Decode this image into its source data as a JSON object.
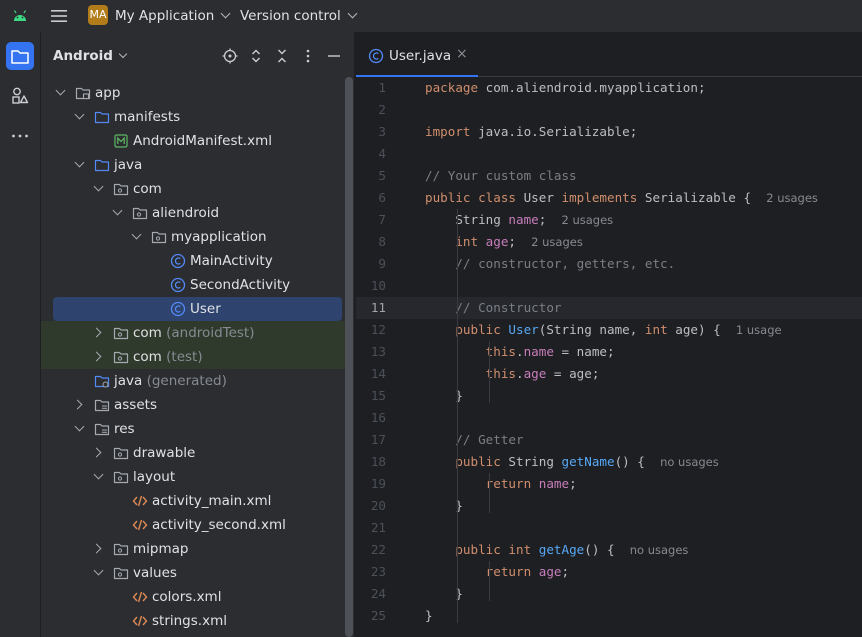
{
  "titlebar": {
    "project_badge": "MA",
    "project_name": "My Application",
    "vcs": "Version control"
  },
  "project_panel": {
    "view": "Android"
  },
  "tree": [
    {
      "label": "app",
      "hint": ""
    },
    {
      "label": "manifests",
      "hint": ""
    },
    {
      "label": "AndroidManifest.xml",
      "hint": ""
    },
    {
      "label": "java",
      "hint": ""
    },
    {
      "label": "com",
      "hint": ""
    },
    {
      "label": "aliendroid",
      "hint": ""
    },
    {
      "label": "myapplication",
      "hint": ""
    },
    {
      "label": "MainActivity",
      "hint": ""
    },
    {
      "label": "SecondActivity",
      "hint": ""
    },
    {
      "label": "User",
      "hint": ""
    },
    {
      "label": "com",
      "hint": "(androidTest)"
    },
    {
      "label": "com",
      "hint": "(test)"
    },
    {
      "label": "java",
      "hint": "(generated)"
    },
    {
      "label": "assets",
      "hint": ""
    },
    {
      "label": "res",
      "hint": ""
    },
    {
      "label": "drawable",
      "hint": ""
    },
    {
      "label": "layout",
      "hint": ""
    },
    {
      "label": "activity_main.xml",
      "hint": ""
    },
    {
      "label": "activity_second.xml",
      "hint": ""
    },
    {
      "label": "mipmap",
      "hint": ""
    },
    {
      "label": "values",
      "hint": ""
    },
    {
      "label": "colors.xml",
      "hint": ""
    },
    {
      "label": "strings.xml",
      "hint": ""
    }
  ],
  "editor": {
    "tab_label": "User.java",
    "tab_close": "×",
    "current_line": 11,
    "lines": [
      {
        "n": "1",
        "tokens": [
          [
            "kw",
            "package "
          ],
          [
            "",
            "com.aliendroid.myapplication;"
          ]
        ]
      },
      {
        "n": "2",
        "tokens": []
      },
      {
        "n": "3",
        "tokens": [
          [
            "kw",
            "import "
          ],
          [
            "",
            "java.io.Serializable;"
          ]
        ]
      },
      {
        "n": "4",
        "tokens": []
      },
      {
        "n": "5",
        "tokens": [
          [
            "cm",
            "// Your custom class"
          ]
        ]
      },
      {
        "n": "6",
        "tokens": [
          [
            "kw",
            "public class "
          ],
          [
            "",
            "User "
          ],
          [
            "kw",
            "implements "
          ],
          [
            "",
            "Serializable {  "
          ],
          [
            "usage",
            "2 usages"
          ]
        ]
      },
      {
        "n": "7",
        "tokens": [
          [
            "",
            "    String "
          ],
          [
            "fld",
            "name"
          ],
          [
            "",
            ";  "
          ],
          [
            "usage",
            "2 usages"
          ]
        ]
      },
      {
        "n": "8",
        "tokens": [
          [
            "kw",
            "    int "
          ],
          [
            "fld",
            "age"
          ],
          [
            "",
            ";  "
          ],
          [
            "usage",
            "2 usages"
          ]
        ]
      },
      {
        "n": "9",
        "tokens": [
          [
            "cm",
            "    // constructor, getters, etc."
          ]
        ]
      },
      {
        "n": "10",
        "tokens": []
      },
      {
        "n": "11",
        "tokens": [
          [
            "cm",
            "    // Constructor"
          ]
        ]
      },
      {
        "n": "12",
        "tokens": [
          [
            "kw",
            "    public "
          ],
          [
            "fn",
            "User"
          ],
          [
            "",
            "(String name, "
          ],
          [
            "kw",
            "int "
          ],
          [
            "",
            "age) {  "
          ],
          [
            "usage",
            "1 usage"
          ]
        ]
      },
      {
        "n": "13",
        "tokens": [
          [
            "kw",
            "        this"
          ],
          [
            "",
            "."
          ],
          [
            "fld",
            "name"
          ],
          [
            "",
            " = name;"
          ]
        ]
      },
      {
        "n": "14",
        "tokens": [
          [
            "kw",
            "        this"
          ],
          [
            "",
            "."
          ],
          [
            "fld",
            "age"
          ],
          [
            "",
            " = age;"
          ]
        ]
      },
      {
        "n": "15",
        "tokens": [
          [
            "",
            "    }"
          ]
        ]
      },
      {
        "n": "16",
        "tokens": []
      },
      {
        "n": "17",
        "tokens": [
          [
            "cm",
            "    // Getter"
          ]
        ]
      },
      {
        "n": "18",
        "tokens": [
          [
            "kw",
            "    public "
          ],
          [
            "",
            "String "
          ],
          [
            "fn",
            "getName"
          ],
          [
            "",
            "() {  "
          ],
          [
            "usage",
            "no usages"
          ]
        ]
      },
      {
        "n": "19",
        "tokens": [
          [
            "kw",
            "        return "
          ],
          [
            "fld",
            "name"
          ],
          [
            "",
            ";"
          ]
        ]
      },
      {
        "n": "20",
        "tokens": [
          [
            "",
            "    }"
          ]
        ]
      },
      {
        "n": "21",
        "tokens": []
      },
      {
        "n": "22",
        "tokens": [
          [
            "kw",
            "    public int "
          ],
          [
            "fn",
            "getAge"
          ],
          [
            "",
            "() {  "
          ],
          [
            "usage",
            "no usages"
          ]
        ]
      },
      {
        "n": "23",
        "tokens": [
          [
            "kw",
            "        return "
          ],
          [
            "fld",
            "age"
          ],
          [
            "",
            ";"
          ]
        ]
      },
      {
        "n": "24",
        "tokens": [
          [
            "",
            "    }"
          ]
        ]
      },
      {
        "n": "25",
        "tokens": [
          [
            "",
            "}"
          ]
        ]
      }
    ]
  },
  "icons": {
    "android": "android-icon",
    "menu": "hamburger-menu-icon",
    "project": "folder-icon",
    "structure": "shapes-icon",
    "more": "more-icon",
    "locate": "crosshair-icon",
    "expand": "expand-icon",
    "collapse": "collapse-icon",
    "options": "kebab-icon",
    "hide": "minimize-icon"
  },
  "colors": {
    "accent": "#3574f0",
    "badge": "#b27c1a",
    "keyword": "#cf8e6d",
    "field": "#c77dbb",
    "function": "#56a8f5",
    "comment": "#7a7e85",
    "class_icon": "#548af7",
    "xml_icon": "#e08855",
    "manifest_icon": "#5fb865"
  }
}
